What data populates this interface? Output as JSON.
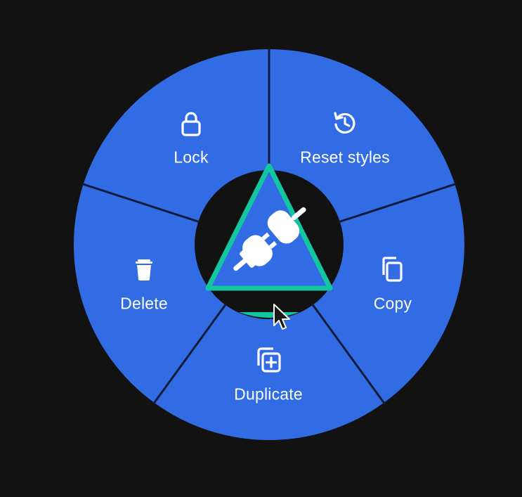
{
  "colors": {
    "background": "#121212",
    "segment_fill": "#326ce5",
    "divider": "#0f1b3a",
    "hub_fill": "#121212",
    "hub_accent": "#12c6a0",
    "icon_color": "#ffffff"
  },
  "center": {
    "icon": "plug-icon",
    "state": "disconnected"
  },
  "menu": {
    "items": [
      {
        "id": "lock",
        "label": "Lock",
        "icon": "lock-icon"
      },
      {
        "id": "reset-styles",
        "label": "Reset styles",
        "icon": "reset-icon"
      },
      {
        "id": "copy",
        "label": "Copy",
        "icon": "copy-icon"
      },
      {
        "id": "duplicate",
        "label": "Duplicate",
        "icon": "duplicate-icon"
      },
      {
        "id": "delete",
        "label": "Delete",
        "icon": "trash-icon"
      }
    ]
  },
  "cursor": {
    "icon": "mouse-pointer-icon"
  }
}
